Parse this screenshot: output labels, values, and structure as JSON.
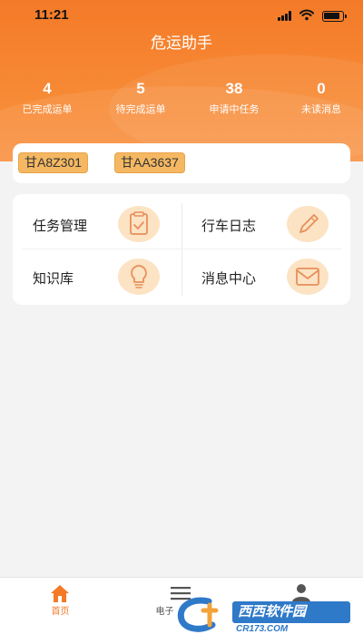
{
  "status_bar": {
    "time": "11:21"
  },
  "app_title": "危运助手",
  "stats": [
    {
      "value": "4",
      "label": "已完成运单"
    },
    {
      "value": "5",
      "label": "待完成运单"
    },
    {
      "value": "38",
      "label": "申请中任务"
    },
    {
      "value": "0",
      "label": "未读消息"
    }
  ],
  "plates": [
    "甘A8Z301",
    "甘AA3637"
  ],
  "menu": [
    {
      "label": "任务管理",
      "icon": "clipboard-icon"
    },
    {
      "label": "行车日志",
      "icon": "pencil-icon"
    },
    {
      "label": "知识库",
      "icon": "lightbulb-icon"
    },
    {
      "label": "消息中心",
      "icon": "envelope-icon"
    }
  ],
  "tabs": [
    {
      "label": "首页",
      "icon": "home-icon",
      "active": true
    },
    {
      "label": "电子",
      "icon": "list-icon",
      "active": false
    },
    {
      "label": "",
      "icon": "user-icon",
      "active": false
    }
  ],
  "watermark": {
    "text": "西西软件园",
    "sub": "CR173.COM"
  },
  "colors": {
    "accent": "#f47a28",
    "plate_bg": "#f5b862",
    "icon_bg": "#fbe3c4",
    "watermark_blue": "#2f79c9"
  }
}
